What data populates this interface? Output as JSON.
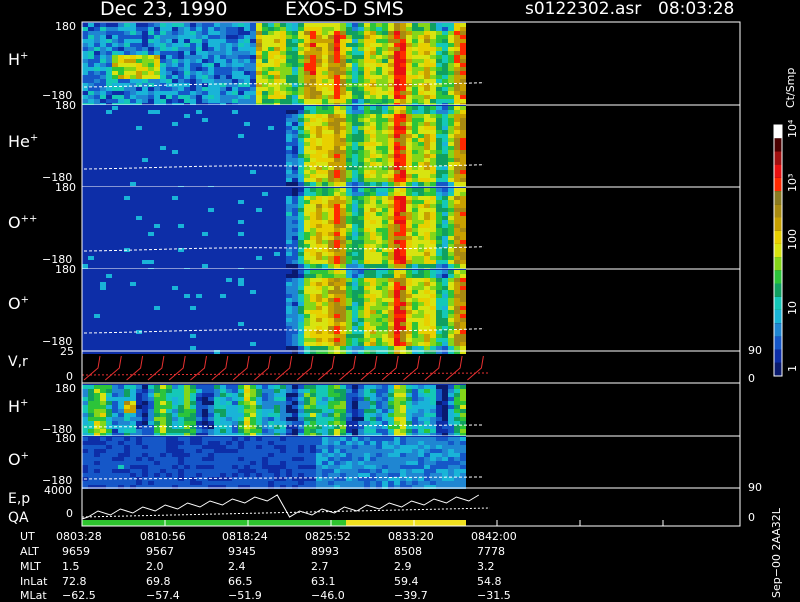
{
  "header": {
    "date_title": "Dec 23, 1990",
    "mission": "EXOS-D SMS",
    "file": "s0122302.asr",
    "time": "08:03:28"
  },
  "colorbar": {
    "unit": "Ct/Smp",
    "labels": [
      "1",
      "10",
      "100",
      "10³",
      "10⁴"
    ],
    "colors": [
      "#0a1a6e",
      "#0d2ea8",
      "#1557c8",
      "#1f86d2",
      "#19b4d8",
      "#14c8b8",
      "#10a060",
      "#2cc43a",
      "#84d619",
      "#d8e410",
      "#e8d000",
      "#c8a000",
      "#a88a10",
      "#8a7a20",
      "#ff2a00",
      "#e81010",
      "#a01010",
      "#4a0000",
      "#ffffff"
    ]
  },
  "panels": [
    {
      "label_main": "H",
      "label_sup": "+",
      "ymax": "180",
      "ymin": "−180"
    },
    {
      "label_main": "He",
      "label_sup": "+",
      "ymax": "180",
      "ymin": "−180"
    },
    {
      "label_main": "O",
      "label_sup": "++",
      "ymax": "180",
      "ymin": "−180"
    },
    {
      "label_main": "O",
      "label_sup": "+",
      "ymax": "180",
      "ymin": "−180"
    }
  ],
  "vr_panel": {
    "label": "V,r",
    "ymax": "25",
    "ymin": "0",
    "r_top": "90",
    "r_bot": "0"
  },
  "low_panels": [
    {
      "label_main": "H",
      "label_sup": "+",
      "ymax": "180",
      "ymin": "−180"
    },
    {
      "label_main": "O",
      "label_sup": "+",
      "ymax": "180",
      "ymin": "−180"
    }
  ],
  "ep_panel": {
    "label": "E,p",
    "label2": "QA",
    "ymax": "4000",
    "ymin": "0",
    "r_top": "90",
    "r_bot": "0"
  },
  "orbit": {
    "row_labels": [
      "UT",
      "ALT",
      "MLT",
      "InLat",
      "MLat"
    ],
    "columns": [
      [
        "0803:28",
        "9659",
        "1.5",
        "72.8",
        "−62.5"
      ],
      [
        "0810:56",
        "9567",
        "2.0",
        "69.8",
        "−57.4"
      ],
      [
        "0818:24",
        "9345",
        "2.4",
        "66.5",
        "−51.9"
      ],
      [
        "0825:52",
        "8993",
        "2.7",
        "63.1",
        "−46.0"
      ],
      [
        "0833:20",
        "8508",
        "2.9",
        "59.4",
        "−39.7"
      ],
      [
        "0842:00",
        "7778",
        "3.2",
        "54.8",
        "−31.5"
      ]
    ]
  },
  "footer_id": "Sep−00  2AA32L",
  "chart_data": {
    "type": "heatmap",
    "title": "Dec 23, 1990   EXOS-D SMS",
    "xlabel": "UT",
    "x_ticks": [
      "0803:28",
      "0810:56",
      "0818:24",
      "0825:52",
      "0833:20",
      "0842:00"
    ],
    "panels": [
      "H+",
      "He+",
      "O++",
      "O+",
      "V,r",
      "H+",
      "O+",
      "E,p / QA"
    ],
    "ylim_angle": [
      -180,
      180
    ],
    "colorbar_range": [
      1,
      10000
    ],
    "colorbar_scale": "log",
    "data_end_fraction": 0.64,
    "qa_segments": [
      {
        "from": "0803:28",
        "to": "0825:52",
        "color": "#2ec42e"
      },
      {
        "from": "0825:52",
        "to": "0838:40",
        "color": "#f0e020"
      }
    ]
  }
}
